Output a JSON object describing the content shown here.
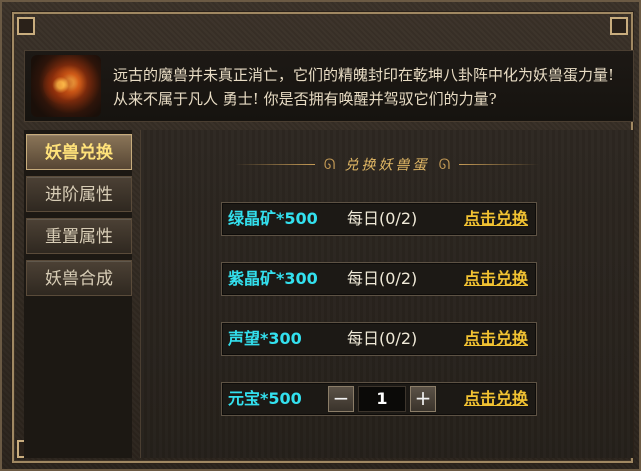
{
  "intro": {
    "text": "远古的魔兽并未真正消亡，它们的精魄封印在乾坤八卦阵中化为妖兽蛋力量! 从来不属于凡人   勇士! 你是否拥有唤醒并驾驭它们的力量?"
  },
  "sidebar": {
    "items": [
      {
        "label": "妖兽兑换",
        "active": true
      },
      {
        "label": "进阶属性",
        "active": false
      },
      {
        "label": "重置属性",
        "active": false
      },
      {
        "label": "妖兽合成",
        "active": false
      }
    ]
  },
  "panel": {
    "heading": "兑换妖兽蛋",
    "rows": [
      {
        "item": "绿晶矿*500",
        "limit": "每日(0/2)",
        "action": "点击兑换"
      },
      {
        "item": "紫晶矿*300",
        "limit": "每日(0/2)",
        "action": "点击兑换"
      },
      {
        "item": "声望*300",
        "limit": "每日(0/2)",
        "action": "点击兑换"
      },
      {
        "item": "元宝*500",
        "minus": "−",
        "quantity": "1",
        "plus": "+",
        "action": "点击兑换"
      }
    ]
  },
  "colors": {
    "item_text": "#33e0ee",
    "action_text": "#f1c232",
    "active_tab_text": "#ffe27a",
    "heading_text": "#e0b765"
  }
}
